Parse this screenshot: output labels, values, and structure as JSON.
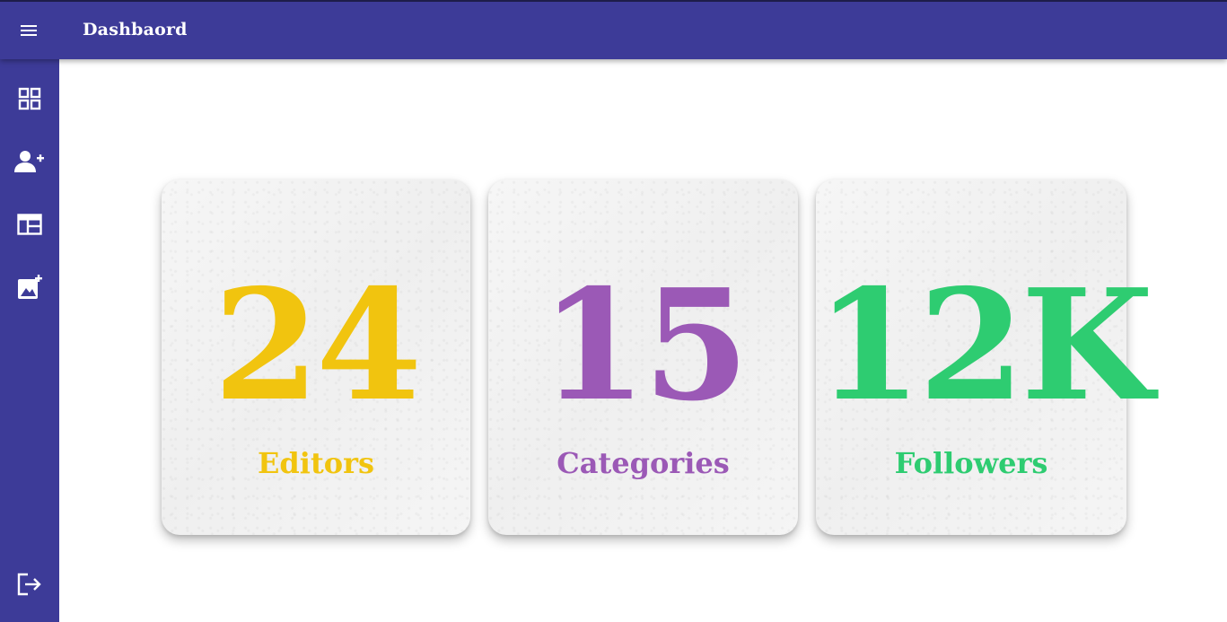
{
  "header": {
    "title": "Dashbaord",
    "menu_icon": "hamburger-menu-icon",
    "background": "#3d3b98"
  },
  "sidebar": {
    "background": "#3d3b98",
    "items": [
      {
        "icon": "grid-dashboard-icon"
      },
      {
        "icon": "add-user-icon"
      },
      {
        "icon": "table-layout-icon"
      },
      {
        "icon": "add-image-icon"
      }
    ],
    "logout": {
      "icon": "logout-icon"
    }
  },
  "stats": [
    {
      "value": "24",
      "label": "Editors",
      "color": "#f1c40f"
    },
    {
      "value": "15",
      "label": "Categories",
      "color": "#9b59b6"
    },
    {
      "value": "12K",
      "label": "Followers",
      "color": "#2ecc71"
    }
  ]
}
